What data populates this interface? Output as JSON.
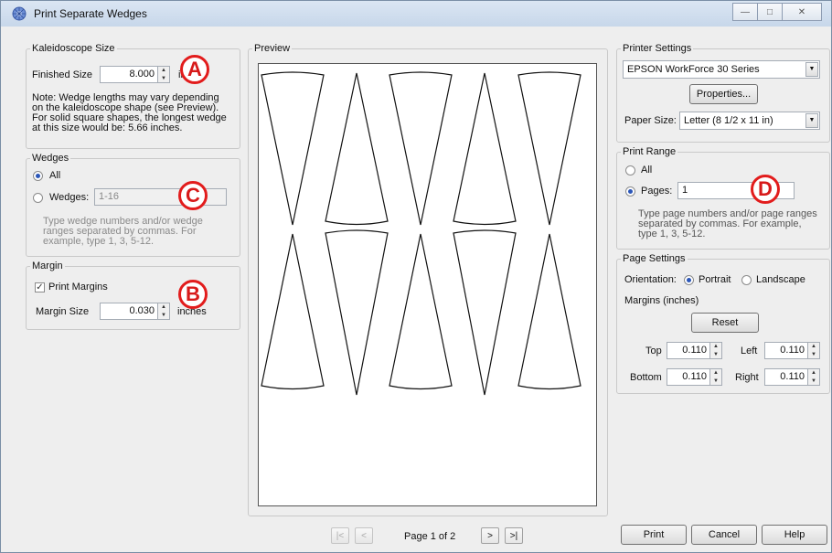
{
  "window": {
    "title": "Print Separate Wedges",
    "icon": "kaleidoscope-icon"
  },
  "kaleidoscope": {
    "label": "Kaleidoscope Size",
    "finished_size_label": "Finished Size",
    "finished_size_value": "8.000",
    "unit": "inches",
    "note": [
      "Note: Wedge lengths may vary depending",
      "on the kaleidoscope shape (see Preview).",
      "For solid square shapes, the longest wedge",
      "at this size would be: 5.66 inches."
    ]
  },
  "wedges": {
    "label": "Wedges",
    "all_label": "All",
    "wedges_label": "Wedges:",
    "wedges_value": "1-16",
    "hint": [
      "Type wedge numbers and/or wedge",
      "ranges separated by commas.  For",
      "example, type 1, 3, 5-12."
    ]
  },
  "margin": {
    "label": "Margin",
    "print_margins_label": "Print Margins",
    "margin_size_label": "Margin Size",
    "margin_size_value": "0.030",
    "unit": "inches"
  },
  "preview": {
    "label": "Preview",
    "page_text": "Page 1 of 2"
  },
  "printer": {
    "label": "Printer Settings",
    "printer_name": "EPSON WorkForce 30 Series",
    "properties_label": "Properties...",
    "paper_size_label": "Paper Size:",
    "paper_size_value": "Letter (8 1/2 x 11 in)"
  },
  "print_range": {
    "label": "Print Range",
    "all_label": "All",
    "pages_label": "Pages:",
    "pages_value": "1",
    "hint": [
      "Type page numbers and/or page ranges",
      "separated by commas.  For example,",
      "type 1, 3, 5-12."
    ]
  },
  "page_settings": {
    "label": "Page Settings",
    "orientation_label": "Orientation:",
    "portrait_label": "Portrait",
    "landscape_label": "Landscape",
    "margins_label": "Margins (inches)",
    "reset_label": "Reset",
    "top_label": "Top",
    "top_value": "0.110",
    "left_label": "Left",
    "left_value": "0.110",
    "bottom_label": "Bottom",
    "bottom_value": "0.110",
    "right_label": "Right",
    "right_value": "0.110"
  },
  "buttons": {
    "print": "Print",
    "cancel": "Cancel",
    "help": "Help"
  },
  "nav": {
    "first": "|<",
    "prev": "<",
    "next": ">",
    "last": ">|"
  },
  "callouts": {
    "a": "A",
    "b": "B",
    "c": "C",
    "d": "D"
  },
  "accent_color": "#e21c1c"
}
